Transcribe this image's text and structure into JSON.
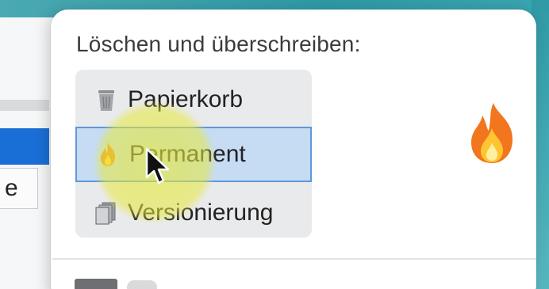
{
  "background": {
    "column_fragment": "e"
  },
  "popover": {
    "title": "Löschen und überschreiben:",
    "options": [
      {
        "label": "Papierkorb",
        "icon": "trash-icon",
        "selected": false
      },
      {
        "label": "Permanent",
        "icon": "flame-icon",
        "selected": true
      },
      {
        "label": "Versionierung",
        "icon": "documents-stack-icon",
        "selected": false
      }
    ],
    "preview_icon": "flame-icon"
  },
  "colors": {
    "selection_fill": "#c5dcf3",
    "selection_border": "#5c98d8",
    "background_selection": "#1a6fd6",
    "cursor_highlight": "#e6e83c"
  }
}
